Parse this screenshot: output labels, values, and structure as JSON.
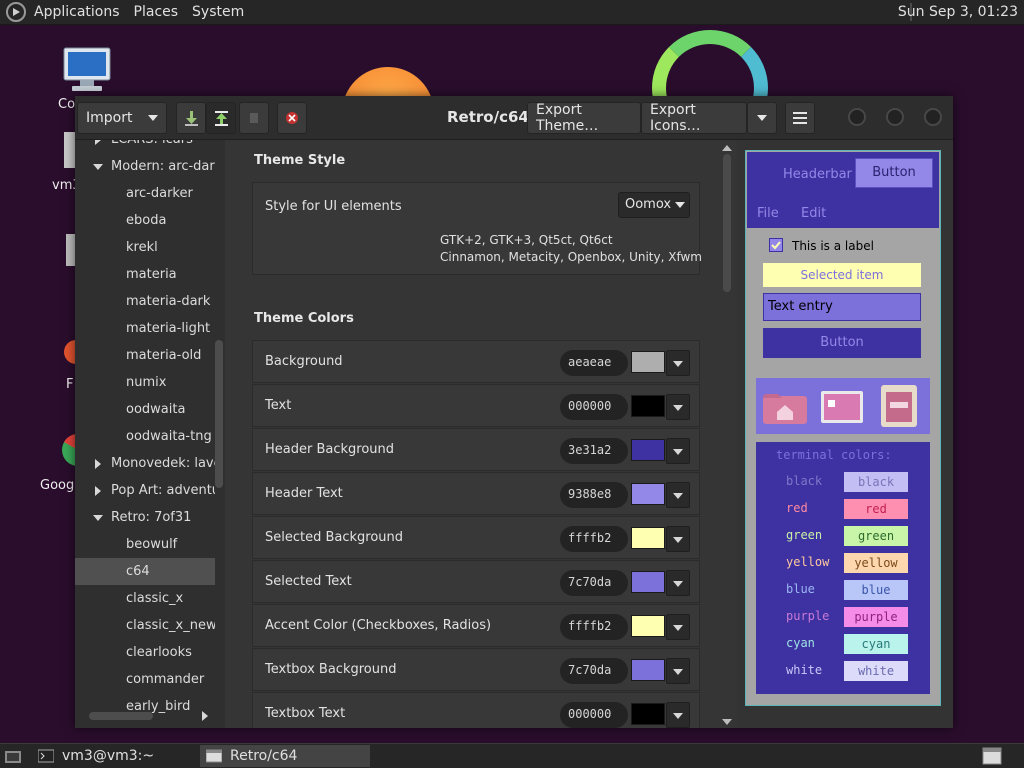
{
  "top_panel": {
    "menus": [
      "Applications",
      "Places",
      "System"
    ],
    "clock": "Sun Sep  3, 01:23"
  },
  "desktop": {
    "icon_labels": [
      "Co",
      "vm3",
      "F",
      "Goog"
    ]
  },
  "window": {
    "title": "Retro/c64",
    "import_label": "Import",
    "export_theme_label": "Export Theme…",
    "export_icons_label": "Export Icons…"
  },
  "sidebar": {
    "items": [
      {
        "label": "LCARS: lcars",
        "level": 0,
        "expander": "collapsed"
      },
      {
        "label": "Modern: arc-dark",
        "level": 0,
        "expander": "expanded"
      },
      {
        "label": "arc-darker",
        "level": 1
      },
      {
        "label": "eboda",
        "level": 1
      },
      {
        "label": "krekl",
        "level": 1
      },
      {
        "label": "materia",
        "level": 1
      },
      {
        "label": "materia-dark",
        "level": 1
      },
      {
        "label": "materia-light",
        "level": 1
      },
      {
        "label": "materia-old",
        "level": 1
      },
      {
        "label": "numix",
        "level": 1
      },
      {
        "label": "oodwaita",
        "level": 1
      },
      {
        "label": "oodwaita-tng",
        "level": 1
      },
      {
        "label": "Monovedek: lave",
        "level": 0,
        "expander": "collapsed"
      },
      {
        "label": "Pop Art: adventu",
        "level": 0,
        "expander": "collapsed"
      },
      {
        "label": "Retro: 7of31",
        "level": 0,
        "expander": "expanded"
      },
      {
        "label": "beowulf",
        "level": 1
      },
      {
        "label": "c64",
        "level": 1,
        "selected": true
      },
      {
        "label": "classic_x",
        "level": 1
      },
      {
        "label": "classic_x_new",
        "level": 1
      },
      {
        "label": "clearlooks",
        "level": 1
      },
      {
        "label": "commander",
        "level": 1
      },
      {
        "label": "early_bird",
        "level": 1
      }
    ]
  },
  "theme_style": {
    "title": "Theme Style",
    "ui_label": "Style for UI elements",
    "dropdown_value": "Oomox",
    "desc1": "GTK+2, GTK+3, Qt5ct, Qt6ct",
    "desc2": "Cinnamon, Metacity, Openbox, Unity, Xfwm"
  },
  "theme_colors": {
    "title": "Theme Colors",
    "rows": [
      {
        "label": "Background",
        "hex": "aeaeae",
        "color": "#aeaeae"
      },
      {
        "label": "Text",
        "hex": "000000",
        "color": "#000000"
      },
      {
        "label": "Header Background",
        "hex": "3e31a2",
        "color": "#3e31a2"
      },
      {
        "label": "Header Text",
        "hex": "9388e8",
        "color": "#9388e8"
      },
      {
        "label": "Selected Background",
        "hex": "ffffb2",
        "color": "#ffffb2"
      },
      {
        "label": "Selected Text",
        "hex": "7c70da",
        "color": "#7c70da"
      },
      {
        "label": "Accent Color (Checkboxes, Radios)",
        "hex": "ffffb2",
        "color": "#ffffb2"
      },
      {
        "label": "Textbox Background",
        "hex": "7c70da",
        "color": "#7c70da"
      },
      {
        "label": "Textbox Text",
        "hex": "000000",
        "color": "#000000"
      }
    ]
  },
  "preview": {
    "headerbar_label": "Headerbar",
    "button_label": "Button",
    "menu_file": "File",
    "menu_edit": "Edit",
    "checkbox_label": "This is a label",
    "selected_item": "Selected item",
    "text_entry": "Text entry",
    "bottom_button": "Button",
    "terminal_title": "terminal colors:",
    "terminal_colors": [
      {
        "name": "black",
        "fg": "#7f77c8",
        "bg": "#c3bff5",
        "fg2": "#7a74b8"
      },
      {
        "name": "red",
        "fg": "#ff8ba0",
        "bg": "#ff8fb0",
        "fg2": "#c02050"
      },
      {
        "name": "green",
        "fg": "#c9f2a6",
        "bg": "#c9f5a8",
        "fg2": "#2e6a2e"
      },
      {
        "name": "yellow",
        "fg": "#ffc9a0",
        "bg": "#ffd7ae",
        "fg2": "#7a4a1a"
      },
      {
        "name": "blue",
        "fg": "#9bb7f2",
        "bg": "#b9c6f8",
        "fg2": "#3a55a8"
      },
      {
        "name": "purple",
        "fg": "#c77ad5",
        "bg": "#f58ce8",
        "fg2": "#902080"
      },
      {
        "name": "cyan",
        "fg": "#9fe3e3",
        "bg": "#baf2ec",
        "fg2": "#2a7a7a"
      },
      {
        "name": "white",
        "fg": "#c8c8f8",
        "bg": "#dcdcfa",
        "fg2": "#6a6ab0"
      }
    ]
  },
  "taskbar": {
    "tasks": [
      "vm3@vm3:~",
      "Retro/c64"
    ]
  }
}
